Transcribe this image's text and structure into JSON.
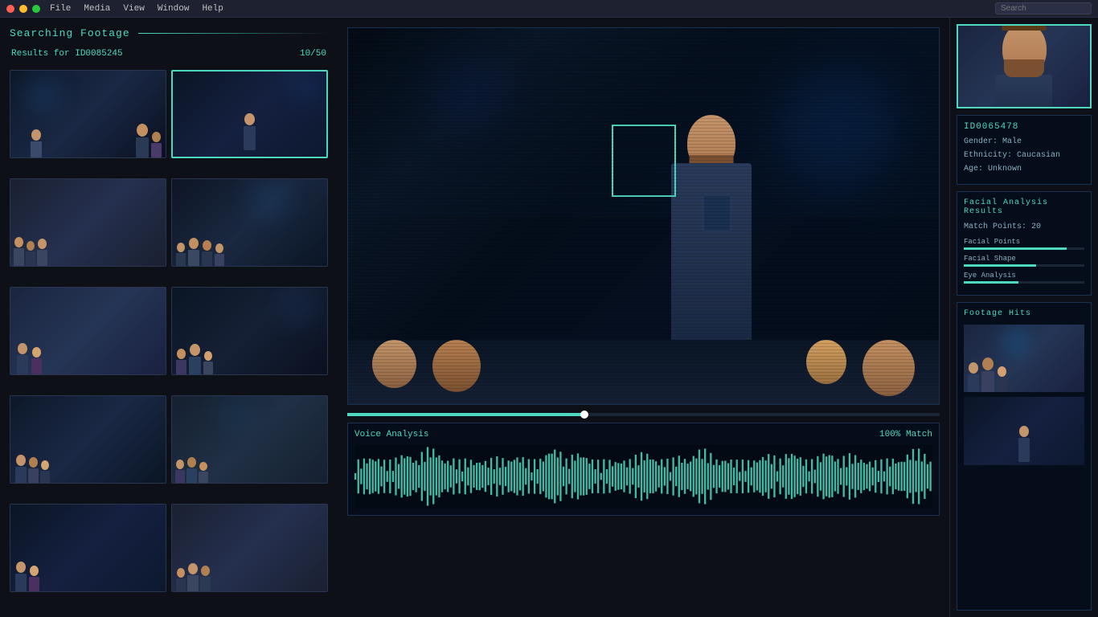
{
  "titlebar": {
    "menu_items": [
      "File",
      "Media",
      "View",
      "Window",
      "Help"
    ],
    "search_placeholder": "Search"
  },
  "left_panel": {
    "section_title": "Searching Footage",
    "results_label": "Results for ID0085245",
    "results_count": "10/50",
    "thumbnails": [
      {
        "id": "t1",
        "active": false,
        "scene": "t1"
      },
      {
        "id": "t2",
        "active": true,
        "scene": "t2"
      },
      {
        "id": "t3",
        "active": false,
        "scene": "t3"
      },
      {
        "id": "t4",
        "active": false,
        "scene": "t4"
      },
      {
        "id": "t5",
        "active": false,
        "scene": "t5"
      },
      {
        "id": "t6",
        "active": false,
        "scene": "t6"
      },
      {
        "id": "t7",
        "active": false,
        "scene": "t7"
      },
      {
        "id": "t8",
        "active": false,
        "scene": "t8"
      },
      {
        "id": "t9",
        "active": false,
        "scene": "t9"
      },
      {
        "id": "t10",
        "active": false,
        "scene": "t10"
      }
    ]
  },
  "center_panel": {
    "voice_analysis_label": "Voice Analysis",
    "match_label": "100% Match"
  },
  "right_panel": {
    "id_info": {
      "id": "ID0065478",
      "gender": "Gender: Male",
      "ethnicity": "Ethnicity: Caucasian",
      "age": "Age: Unknown"
    },
    "facial_analysis": {
      "title": "Facial Analysis Results",
      "match_points": "Match Points: 20",
      "metrics": [
        {
          "label": "Facial Points",
          "pct": 85
        },
        {
          "label": "Facial Shape",
          "pct": 60
        },
        {
          "label": "Eye Analysis",
          "pct": 45
        }
      ]
    },
    "footage_hits": {
      "title": "Footage Hits"
    }
  }
}
